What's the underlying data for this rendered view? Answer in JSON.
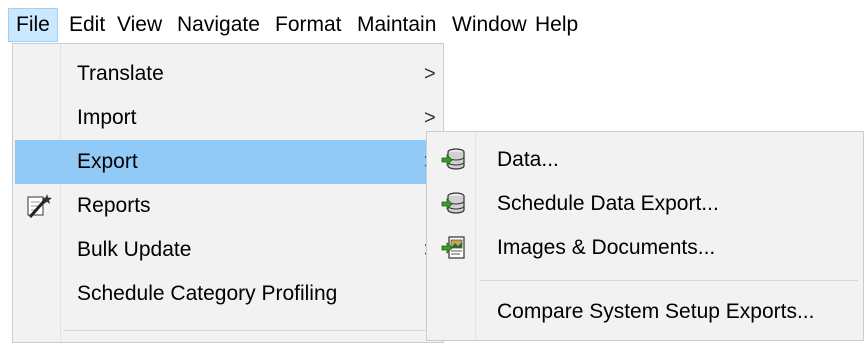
{
  "menubar": {
    "items": [
      "File",
      "Edit",
      "View",
      "Navigate",
      "Format",
      "Maintain",
      "Window",
      "Help"
    ]
  },
  "file_menu": {
    "items": [
      {
        "label": "Translate",
        "submenu_arrow": ">"
      },
      {
        "label": "Import",
        "submenu_arrow": ">"
      },
      {
        "label": "Export",
        "submenu_arrow": ">",
        "highlighted": true
      },
      {
        "label": "Reports",
        "icon": "magic-wand-icon"
      },
      {
        "label": "Bulk Update",
        "submenu_arrow": ">"
      },
      {
        "label": "Schedule Category Profiling"
      }
    ]
  },
  "export_submenu": {
    "items": [
      {
        "label": "Data...",
        "icon": "database-export-icon"
      },
      {
        "label": "Schedule Data Export...",
        "icon": "database-schedule-icon"
      },
      {
        "label": "Images & Documents...",
        "icon": "images-documents-export-icon"
      },
      {
        "label": "Compare System Setup Exports..."
      }
    ]
  },
  "colors": {
    "highlight": "#91c9f7",
    "menubar_active": "#cce8ff",
    "menu_background": "#f2f2f2"
  }
}
